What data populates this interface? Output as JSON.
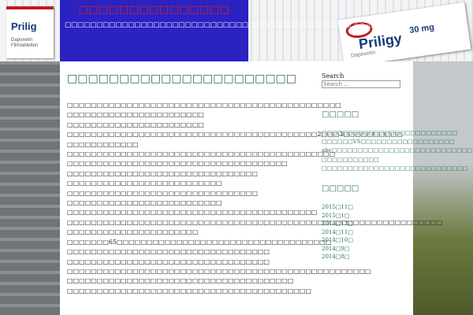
{
  "header": {
    "site_title": "□□□□□□□□□□□□□□□",
    "site_description": "□□□□□□□□□□□□□□□□□□□□□□□□□□□□□□□□□□□□□□□□□□□□□□□□□",
    "package_left": {
      "brand": "Prilig",
      "small_text": "Dapoxetin Filmtabletten"
    },
    "package_right": {
      "brand": "Priligy",
      "dose": "30 mg",
      "sub": "Dapoxetin"
    }
  },
  "post": {
    "title": "□□□□□□□□□□□□□□□□□□□□□□",
    "lines": [
      "□□□□□□□□□□□□□□□□□□□□□□□□□□□□□□□□□□□□□□□□□□□□□□",
      "□□□□□□□□□□□□□□□□□□□□□□□",
      "□□□□□□□□□□□□□□□□□□□□□□□",
      "□□□□□□□□□□□□□□□□□□□□□□□□□□□□□□□□□□□□□□□□□□2□□□3□□□□□□□□□□",
      "□□□□□□□□□□□□",
      "□□□□□□□□□□□□□□□□□□□□□□□□□□□□□□□□□□□□□□□□□□□□□",
      "□□□□□□□□□□□□□□□□□□□□□□□□□□□□□□□□□□□□□",
      "□□□□□□□□□□□□□□□□□□□□□□□□□□□□□□□□",
      "□□□□□□□□□□□□□□□□□□□□□□□□□□",
      "□□□□□□□□□□□□□□□□□□□□□□□□□□□□□□□□",
      "□□□□□□□□□□□□□□□□□□□□□□□□□□",
      "□□□□□□□□□□□□□□□□□□□□□□□□□□□□□□□□□□□□□□□□□□",
      "□□□□□□□□□□□□□□□□□□□□□□□□□□□□□□□□□□□□□□□□□□□□□□□□□□□□□□□□□□□□□□□",
      "□□□□□□□□□□□□□□□□□□□□□□",
      "□□□□□□□65□□□□□□□□□□□□□□□□□□□□□□□□□□□□□□□□□□□□",
      "□□□□□□□□□□□□□□□□□□□□□□□□□□□□□□□□□□",
      "□□□□□□□□□□□□□□□□□□□□□□□□□□□□□□□□□□",
      "□□□□□□□□□□□□□□□□□□□□□□□□□□□□□□□□□□□□□□□□□□□□□□□□□□□",
      "□□□□□□□□□□□□□□□□□□□□□□□□□□□□□□□□□□□□□□",
      "□□□□□□□□□□□□□□□□□□□□□□□□□□□□□□□□□□□□□□□□□"
    ]
  },
  "sidebar": {
    "search_label": "Search",
    "search_placeholder": "Search ...",
    "widget1_title": "□□□□□",
    "widget1_items": [
      "□□□□□□□□□□□□□□□□□□□□□□□□□□",
      "□□□□□□VS□□□□□□□□□□□□□□□□□□",
      "abc□□□□□□□□□□□□□□□□□□□□□□□□□□□",
      "□□□□□□□□□□□",
      "□□□□□□□□□□□□□□□□□□□□□□□□□□□□"
    ],
    "widget2_title": "□□□□□",
    "archive_items": [
      "2015□11□",
      "2015□1□",
      "2014□12□",
      "2014□11□",
      "2014□10□",
      "2014□9□",
      "2014□8□"
    ]
  }
}
